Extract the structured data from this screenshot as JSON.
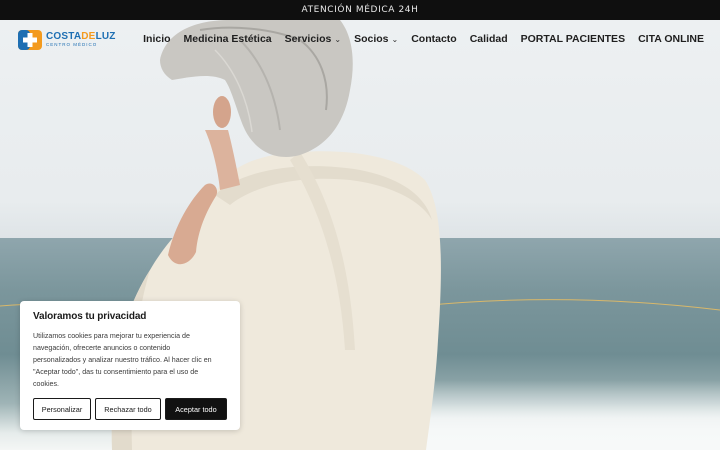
{
  "topbar": {
    "text": "ATENCIÓN MÉDICA 24H"
  },
  "logo": {
    "main_a": "COSTA",
    "main_b": "DE",
    "main_c": "LUZ",
    "sub": "CENTRO MÉDICO"
  },
  "nav": {
    "items": [
      {
        "label": "Inicio",
        "dropdown": false
      },
      {
        "label": "Medicina Estética",
        "dropdown": false
      },
      {
        "label": "Servicios",
        "dropdown": true
      },
      {
        "label": "Socios",
        "dropdown": true
      },
      {
        "label": "Contacto",
        "dropdown": false
      },
      {
        "label": "Calidad",
        "dropdown": false
      },
      {
        "label": "PORTAL PACIENTES",
        "dropdown": false
      },
      {
        "label": "CITA ONLINE",
        "dropdown": false
      }
    ],
    "chevron": "⌄"
  },
  "cookie": {
    "title": "Valoramos tu privacidad",
    "lines": [
      "Utilizamos cookies para mejorar tu experiencia de",
      "navegación, ofrecerte anuncios o contenido",
      "personalizados y analizar nuestro tráfico. Al hacer clic en",
      "\"Aceptar todo\", das tu consentimiento para el uso de",
      "cookies."
    ],
    "buttons": {
      "customize": "Personalizar",
      "reject": "Rechazar todo",
      "accept": "Aceptar todo"
    }
  },
  "colors": {
    "brand_blue": "#1e6fb3",
    "brand_orange": "#f39a1e",
    "topbar_bg": "#0f0f0f",
    "gold_line": "#d9b86a"
  },
  "icons": {
    "logo": "medical-cross-icon",
    "chevron": "chevron-down-icon"
  }
}
